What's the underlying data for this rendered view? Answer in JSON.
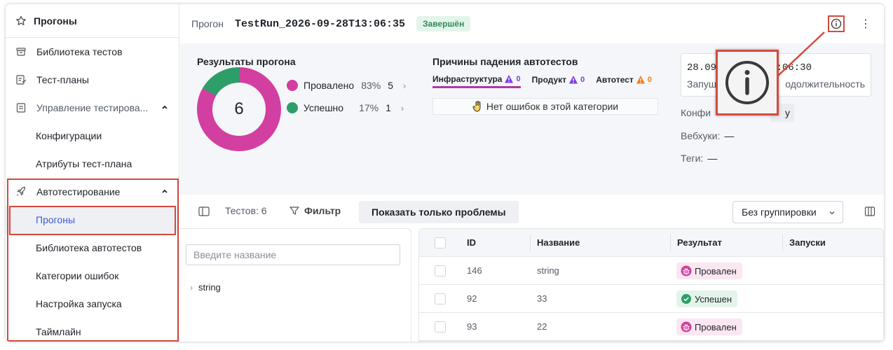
{
  "sidebar": {
    "header": "Прогоны",
    "items": [
      {
        "label": "Библиотека тестов"
      },
      {
        "label": "Тест-планы"
      },
      {
        "label": "Управление тестирова..."
      },
      {
        "label": "Конфигурации"
      },
      {
        "label": "Атрибуты тест-плана"
      },
      {
        "label": "Автотестирование"
      },
      {
        "label": "Прогоны"
      },
      {
        "label": "Библиотека автотестов"
      },
      {
        "label": "Категории ошибок"
      },
      {
        "label": "Настройка запуска"
      },
      {
        "label": "Таймлайн"
      }
    ]
  },
  "topbar": {
    "crumb": "Прогон",
    "run_name": "TestRun_2026-09-28T13:06:35",
    "status": "Завершён",
    "more": "⋮"
  },
  "results": {
    "title": "Результаты прогона",
    "total": "6",
    "failed": {
      "label": "Провалено",
      "pct": "83%",
      "count": "5",
      "color": "#d23fa0"
    },
    "passed": {
      "label": "Успешно",
      "pct": "17%",
      "count": "1",
      "color": "#2e9e68"
    }
  },
  "causes": {
    "title": "Причины падения автотестов",
    "tabs": [
      {
        "label": "Инфраструктура",
        "count": "0",
        "color": "#7b3fe4"
      },
      {
        "label": "Продукт",
        "count": "0",
        "color": "#7b3fe4"
      },
      {
        "label": "Автотест",
        "count": "0",
        "color": "#f07e16"
      }
    ],
    "empty": "Нет ошибок в этой категории"
  },
  "info": {
    "date": "28.09",
    "time": ":06:30",
    "started_label": "Запущ",
    "duration_label": "одолжительность",
    "config_label": "Конфи",
    "config_value": "у",
    "webhooks_label": "Вебхуки:",
    "webhooks_value": "—",
    "tags_label": "Теги:",
    "tags_value": "—"
  },
  "toolbar": {
    "count": "Тестов: 6",
    "filter": "Фильтр",
    "problems": "Показать только проблемы",
    "grouping": "Без группировки"
  },
  "tree": {
    "search_placeholder": "Введите название",
    "node": "string"
  },
  "table": {
    "columns": [
      "ID",
      "Название",
      "Результат",
      "Запуски"
    ],
    "rows": [
      {
        "id": "146",
        "name": "string",
        "result": "Провален"
      },
      {
        "id": "92",
        "name": "33",
        "result": "Успешен"
      },
      {
        "id": "93",
        "name": "22",
        "result": "Провален"
      }
    ]
  }
}
